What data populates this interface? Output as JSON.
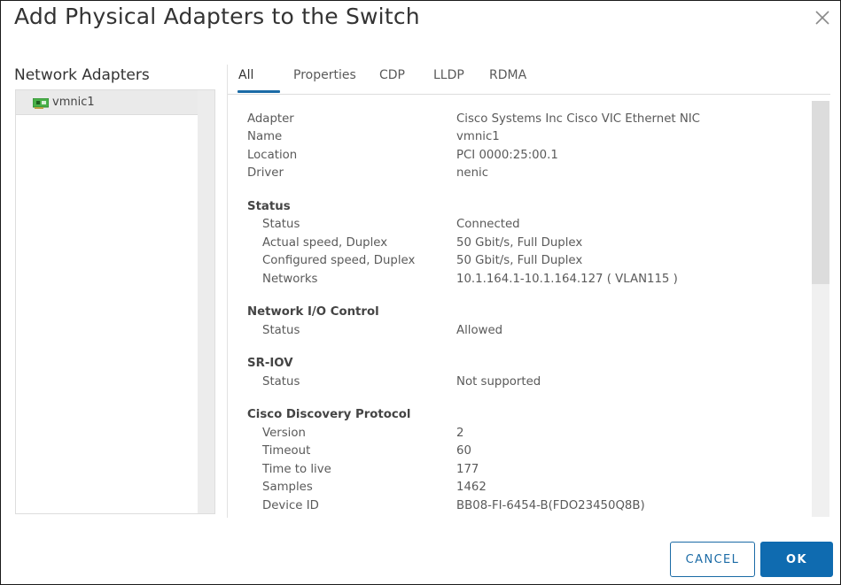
{
  "dialog": {
    "title": "Add Physical Adapters to the Switch",
    "close_icon": "close-icon"
  },
  "left_panel": {
    "title": "Network Adapters",
    "adapters": [
      {
        "label": "vmnic1",
        "icon": "network-card-icon",
        "selected": true
      }
    ]
  },
  "tabs": [
    {
      "label": "All",
      "active": true
    },
    {
      "label": "Properties",
      "active": false
    },
    {
      "label": "CDP",
      "active": false
    },
    {
      "label": "LLDP",
      "active": false
    },
    {
      "label": "RDMA",
      "active": false
    }
  ],
  "details": {
    "general": [
      {
        "key": "Adapter",
        "value": "Cisco Systems Inc Cisco VIC Ethernet NIC"
      },
      {
        "key": "Name",
        "value": "vmnic1"
      },
      {
        "key": "Location",
        "value": "PCI 0000:25:00.1"
      },
      {
        "key": "Driver",
        "value": "nenic"
      }
    ],
    "status": {
      "title": "Status",
      "rows": [
        {
          "key": "Status",
          "value": "Connected"
        },
        {
          "key": "Actual speed, Duplex",
          "value": "50 Gbit/s, Full Duplex"
        },
        {
          "key": "Configured speed, Duplex",
          "value": "50 Gbit/s, Full Duplex"
        },
        {
          "key": "Networks",
          "value": "10.1.164.1-10.1.164.127 ( VLAN115 )"
        }
      ]
    },
    "nioc": {
      "title": "Network I/O Control",
      "rows": [
        {
          "key": "Status",
          "value": "Allowed"
        }
      ]
    },
    "sriov": {
      "title": "SR-IOV",
      "rows": [
        {
          "key": "Status",
          "value": "Not supported"
        }
      ]
    },
    "cdp": {
      "title": "Cisco Discovery Protocol",
      "rows": [
        {
          "key": "Version",
          "value": "2"
        },
        {
          "key": "Timeout",
          "value": "60"
        },
        {
          "key": "Time to live",
          "value": "177"
        },
        {
          "key": "Samples",
          "value": "1462"
        },
        {
          "key": "Device ID",
          "value": "BB08-FI-6454-B(FDO23450Q8B)"
        }
      ]
    }
  },
  "footer": {
    "cancel_label": "CANCEL",
    "ok_label": "OK"
  },
  "colors": {
    "accent": "#0f6bb0",
    "tab_underline": "#1b6ba6",
    "nic_icon": "#3fae3f"
  }
}
